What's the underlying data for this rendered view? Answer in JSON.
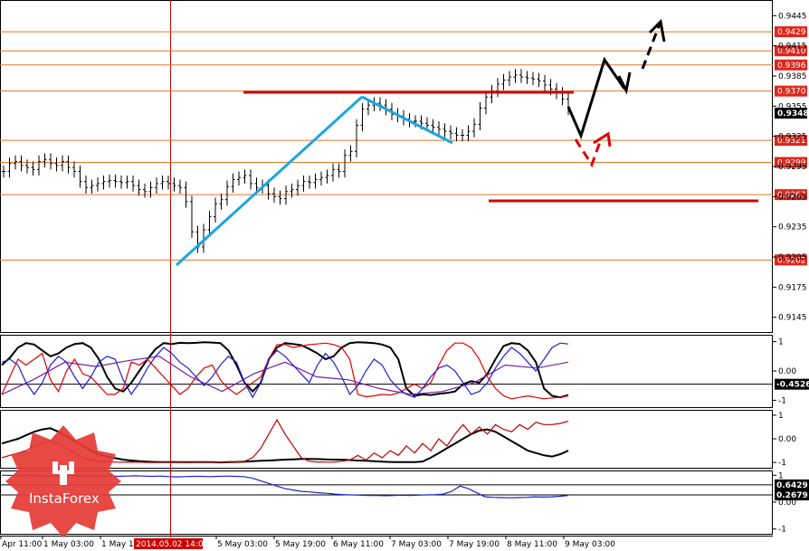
{
  "chart_data": {
    "type": "line",
    "main_price": {
      "yticks": [
        "0.9445",
        "0.9415",
        "0.9385",
        "0.9355",
        "0.9325",
        "0.9295",
        "0.9265",
        "0.9235",
        "0.9205",
        "0.9175",
        "0.9145"
      ],
      "levels": [
        {
          "label": "0.9429",
          "value": 0.9429
        },
        {
          "label": "0.9410",
          "value": 0.941
        },
        {
          "label": "0.9396",
          "value": 0.9396
        },
        {
          "label": "0.9370",
          "value": 0.937
        },
        {
          "label": "0.9321",
          "value": 0.9321
        },
        {
          "label": "0.9299",
          "value": 0.9299
        },
        {
          "label": "0.9267",
          "value": 0.9267
        },
        {
          "label": "0.9202",
          "value": 0.9202
        }
      ],
      "current_price": {
        "label": "0.9348",
        "value": 0.9348
      },
      "close_series": [
        0.929,
        0.9298,
        0.93,
        0.9296,
        0.9294,
        0.9292,
        0.93,
        0.9302,
        0.9298,
        0.9296,
        0.93,
        0.9294,
        0.929,
        0.928,
        0.9274,
        0.9276,
        0.9278,
        0.928,
        0.9281,
        0.928,
        0.9279,
        0.928,
        0.9276,
        0.9272,
        0.927,
        0.9274,
        0.9278,
        0.928,
        0.9278,
        0.9276,
        0.9274,
        0.926,
        0.923,
        0.9215,
        0.9232,
        0.9245,
        0.9258,
        0.9262,
        0.9275,
        0.9282,
        0.9284,
        0.9286,
        0.9278,
        0.9274,
        0.9276,
        0.9268,
        0.9265,
        0.9263,
        0.927,
        0.9272,
        0.9276,
        0.928,
        0.9279,
        0.9282,
        0.9284,
        0.9286,
        0.9292,
        0.929,
        0.9306,
        0.931,
        0.9336,
        0.9352,
        0.9356,
        0.9358,
        0.9356,
        0.9352,
        0.9347,
        0.9345,
        0.9342,
        0.934,
        0.934,
        0.9338,
        0.9336,
        0.9334,
        0.9332,
        0.933,
        0.9328,
        0.9326,
        0.9326,
        0.933,
        0.9337,
        0.9353,
        0.9364,
        0.937,
        0.9377,
        0.9381,
        0.9384,
        0.9386,
        0.9384,
        0.9383,
        0.9382,
        0.938,
        0.9376,
        0.9372,
        0.9368,
        0.9362,
        0.9352
      ],
      "ylim": [
        0.9133,
        0.9457
      ]
    },
    "oscillator_1": {
      "yticks": [
        "1",
        "0.00",
        "-1"
      ],
      "level": {
        "label": "-0.4526",
        "value": -0.4526
      },
      "series": [
        {
          "color": "#000000",
          "values": [
            0.2,
            0.45,
            0.8,
            0.95,
            0.9,
            0.7,
            0.5,
            0.6,
            0.8,
            0.92,
            0.95,
            0.8,
            0.4,
            -0.2,
            -0.6,
            -0.7,
            -0.4,
            0.0,
            0.4,
            0.75,
            0.95,
            0.92,
            0.96,
            0.95,
            0.96,
            0.98,
            0.97,
            0.95,
            0.7,
            0.2,
            -0.4,
            -0.7,
            -0.4,
            0.4,
            0.8,
            0.95,
            0.92,
            0.88,
            0.75,
            0.6,
            0.4,
            0.5,
            0.8,
            0.95,
            0.98,
            0.97,
            0.95,
            0.9,
            0.8,
            0.4,
            -0.6,
            -0.85,
            -0.8,
            -0.82,
            -0.78,
            -0.75,
            -0.7,
            -0.45,
            -0.35,
            -0.4,
            -0.1,
            0.4,
            0.85,
            0.95,
            0.92,
            0.7,
            0.3,
            -0.6,
            -0.85,
            -0.9,
            -0.82
          ]
        },
        {
          "color": "#e00000",
          "values": [
            -0.8,
            -0.2,
            0.4,
            0.2,
            0.4,
            0.6,
            -0.3,
            -0.7,
            0.0,
            0.4,
            -0.1,
            -0.2,
            -0.5,
            -0.8,
            -0.8,
            -0.6,
            0.3,
            0.2,
            0.4,
            0.1,
            -0.2,
            -0.5,
            -0.8,
            -0.6,
            -0.2,
            0.1,
            0.2,
            -0.3,
            -0.6,
            -0.8,
            -0.6,
            -0.4,
            -0.2,
            0.4,
            0.9,
            0.9,
            0.8,
            0.85,
            0.9,
            0.92,
            0.95,
            0.9,
            0.8,
            0.4,
            -0.8,
            -0.88,
            -0.85,
            -0.8,
            -0.82,
            -0.75,
            -0.6,
            -0.45,
            -0.6,
            -0.4,
            0.2,
            0.7,
            0.95,
            0.95,
            0.8,
            0.4,
            -0.2,
            -0.6,
            -0.85,
            -0.95,
            -0.9,
            -0.85,
            -0.9,
            -0.95,
            -0.92,
            -0.9,
            -0.85
          ]
        },
        {
          "color": "#7a1fa2",
          "values": [
            -0.8,
            -0.3,
            0.3,
            0.15,
            0.35,
            0.5,
            -0.2,
            -0.7,
            -0.1,
            0.3,
            -0.2,
            -0.3,
            -0.6,
            -0.8,
            -0.7,
            -0.4,
            0.2,
            0.1,
            0.3
          ]
        },
        {
          "color": "#2020d0",
          "values": [
            0.3,
            0.4,
            0.2,
            -0.4,
            -0.8,
            -0.4,
            0.2,
            0.5,
            0.3,
            -0.2,
            -0.6,
            -0.2,
            0.3,
            0.5,
            0.4,
            -0.3,
            -0.8,
            -0.4,
            0.1,
            0.5,
            0.8,
            0.6,
            0.3,
            0.1,
            -0.2,
            -0.5,
            -0.2,
            0.2,
            0.5,
            0.3,
            -0.4,
            -0.9,
            -0.4,
            0.4,
            0.7,
            0.5,
            0.2,
            -0.1,
            -0.4,
            0.2,
            0.6,
            0.3,
            -0.2,
            -0.8,
            -0.5,
            0.0,
            0.4,
            0.2,
            -0.3,
            -0.6,
            -0.8,
            -0.9,
            -0.6,
            -0.2,
            0.1,
            0.2,
            0.0,
            -0.4,
            -0.8,
            -0.7,
            -0.4,
            0.1,
            0.5,
            0.8,
            0.6,
            0.3,
            0.0,
            0.4,
            0.8,
            0.95,
            0.92
          ]
        }
      ]
    },
    "oscillator_2": {
      "yticks": [
        "1",
        "0.00",
        "-1"
      ],
      "series": [
        {
          "color": "#000000",
          "values": [
            -0.2,
            -0.1,
            0.0,
            0.15,
            0.3,
            0.4,
            0.45,
            0.3,
            0.1,
            -0.1,
            -0.3,
            -0.5,
            -0.65,
            -0.75,
            -0.82,
            -0.88,
            -0.92,
            -0.95,
            -0.97,
            -0.98,
            -0.99,
            -0.98,
            -0.99,
            -0.99,
            -0.99,
            -0.99,
            -0.99,
            -1.0,
            -0.99,
            -0.98,
            -0.97,
            -0.95,
            -0.93,
            -0.92,
            -0.9,
            -0.88,
            -0.87,
            -0.85,
            -0.85,
            -0.86,
            -0.87,
            -0.88,
            -0.88,
            -0.9,
            -0.92,
            -0.93,
            -0.95,
            -0.97,
            -0.98,
            -0.99,
            -0.99,
            -0.99,
            -0.96,
            -0.8,
            -0.6,
            -0.4,
            -0.2,
            0.0,
            0.2,
            0.35,
            0.4,
            0.3,
            0.1,
            -0.1,
            -0.3,
            -0.5,
            -0.6,
            -0.7,
            -0.75,
            -0.65,
            -0.5
          ]
        },
        {
          "color": "#c00000",
          "values": [
            -0.8,
            -0.7,
            -0.6,
            -0.5,
            -0.3,
            -0.2,
            -0.1,
            -0.2,
            -0.4,
            -0.6,
            -0.8,
            -0.9,
            -0.95,
            -0.98,
            -0.99,
            -0.99,
            -0.98,
            -0.99,
            -1.0,
            -1.0,
            -0.99,
            -0.99,
            -0.99,
            -1.0,
            -0.99,
            -0.99,
            -0.99,
            -0.98,
            -0.97,
            -0.99,
            -0.95,
            -0.8,
            -0.4,
            0.2,
            0.8,
            0.2,
            -0.3,
            -0.8,
            -0.95,
            -0.98,
            -0.99,
            -0.99,
            -0.95,
            -0.9,
            -0.7,
            -0.9,
            -0.6,
            -0.8,
            -0.5,
            -0.7,
            -0.3,
            -0.6,
            -0.2,
            -0.5,
            0.0,
            -0.3,
            0.2,
            0.6,
            0.2,
            0.5,
            0.2,
            0.6,
            0.4,
            0.3,
            0.6,
            0.4,
            0.7,
            0.6,
            0.6,
            0.65,
            0.75
          ]
        }
      ]
    },
    "oscillator_3": {
      "yticks": [
        "1",
        "0.00",
        "-1"
      ],
      "levels": [
        {
          "label": "0.6429",
          "value": 0.6429
        },
        {
          "label": "0.2679",
          "value": 0.2679
        }
      ],
      "series": [
        {
          "color": "#2020d0",
          "values": [
            1.0,
            1.0,
            0.98,
            1.0,
            1.0,
            0.96,
            0.98,
            0.97,
            0.98,
            0.99,
            0.98,
            0.97,
            0.96,
            0.97,
            0.96,
            0.97,
            0.98,
            0.97,
            0.96,
            0.97,
            0.95,
            0.94,
            0.95,
            0.96,
            0.96,
            0.95,
            0.96,
            0.97,
            0.96,
            0.95,
            0.9,
            0.8,
            0.7,
            0.6,
            0.5,
            0.45,
            0.4,
            0.38,
            0.35,
            0.33,
            0.3,
            0.28,
            0.27,
            0.26,
            0.25,
            0.25,
            0.24,
            0.25,
            0.26,
            0.25,
            0.26,
            0.27,
            0.28,
            0.3,
            0.4,
            0.6,
            0.5,
            0.35,
            0.2,
            0.18,
            0.17,
            0.16,
            0.17,
            0.18,
            0.2,
            0.19,
            0.2,
            0.22,
            0.25
          ]
        }
      ]
    },
    "x_tick_labels": [
      "Apr 11:00",
      "1 May 03:00",
      "1 May 19:00",
      "5 May 03:00",
      "5 May 19:00",
      "6 May 11:00",
      "7 May 03:00",
      "7 May 19:00",
      "8 May 11:00",
      "9 May 03:00"
    ],
    "x_highlight_label": "2014.05.02 14:00"
  },
  "logo": {
    "text": "InstaForex"
  }
}
